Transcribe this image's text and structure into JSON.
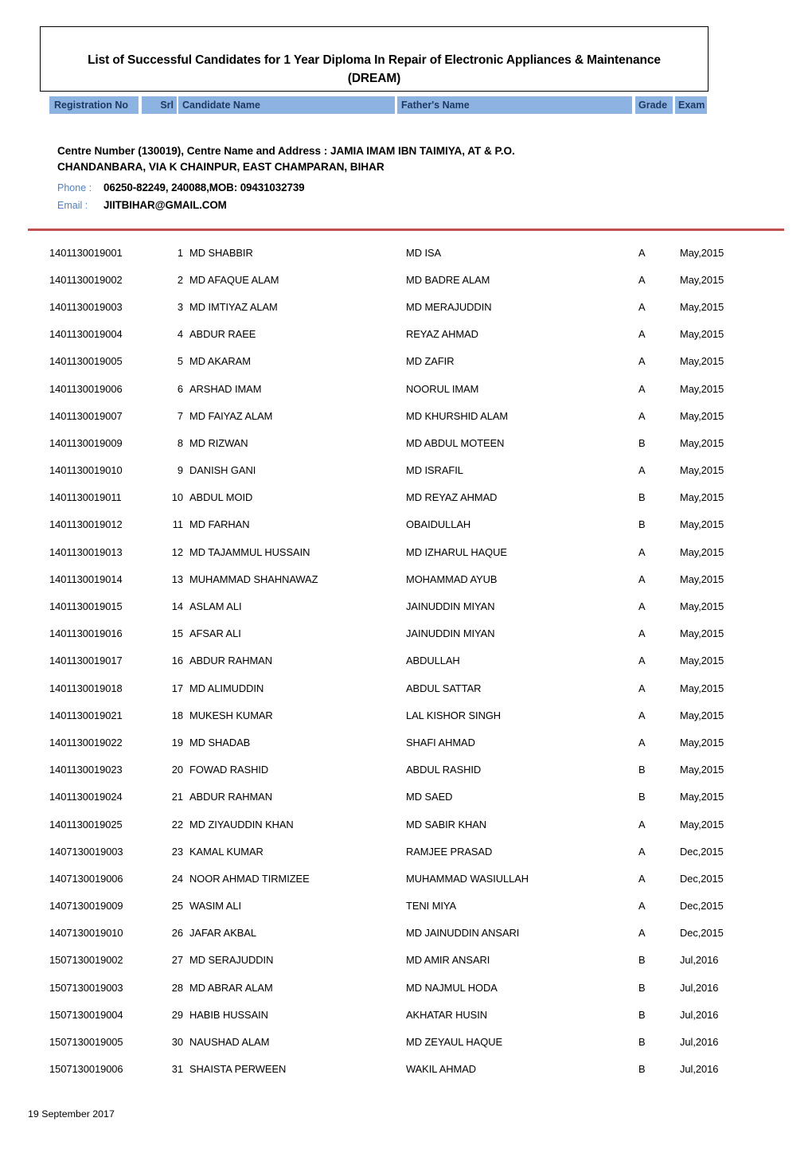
{
  "document": {
    "title_line1": "List of Successful Candidates for 1 Year Diploma In Repair of Electronic Appliances & Maintenance",
    "title_line2": "(DREAM)",
    "footer_date": "19 September 2017",
    "accent_header_bg": "#8db3e2",
    "accent_header_text": "#1f3864",
    "accent_rule": "#c0504d",
    "accent_label": "#4f81bd"
  },
  "columns": {
    "registration_no": "Registration No",
    "srl": "Srl",
    "candidate_name": "Candidate Name",
    "fathers_name": "Father's Name",
    "grade": "Grade",
    "exam": "Exam"
  },
  "centre": {
    "address_line1": "Centre Number (130019), Centre Name and Address : JAMIA IMAM IBN TAIMIYA, AT & P.O.",
    "address_line2": "CHANDANBARA,    VIA K CHAINPUR, EAST CHAMPARAN, BIHAR",
    "phone_label": "Phone :",
    "phone_value": "06250-82249, 240088,MOB: 09431032739",
    "email_label": "Email :",
    "email_value": "JIITBIHAR@GMAIL.COM"
  },
  "rows": [
    {
      "reg": "1401130019001",
      "srl": "1",
      "candidate": "MD SHABBIR",
      "father": "MD ISA",
      "grade": "A",
      "exam": "May,2015"
    },
    {
      "reg": "1401130019002",
      "srl": "2",
      "candidate": "MD AFAQUE ALAM",
      "father": "MD BADRE ALAM",
      "grade": "A",
      "exam": "May,2015"
    },
    {
      "reg": "1401130019003",
      "srl": "3",
      "candidate": "MD IMTIYAZ ALAM",
      "father": "MD MERAJUDDIN",
      "grade": "A",
      "exam": "May,2015"
    },
    {
      "reg": "1401130019004",
      "srl": "4",
      "candidate": "ABDUR RAEE",
      "father": "REYAZ AHMAD",
      "grade": "A",
      "exam": "May,2015"
    },
    {
      "reg": "1401130019005",
      "srl": "5",
      "candidate": "MD AKARAM",
      "father": "MD ZAFIR",
      "grade": "A",
      "exam": "May,2015"
    },
    {
      "reg": "1401130019006",
      "srl": "6",
      "candidate": "ARSHAD IMAM",
      "father": "NOORUL IMAM",
      "grade": "A",
      "exam": "May,2015"
    },
    {
      "reg": "1401130019007",
      "srl": "7",
      "candidate": "MD FAIYAZ ALAM",
      "father": "MD KHURSHID ALAM",
      "grade": "A",
      "exam": "May,2015"
    },
    {
      "reg": "1401130019009",
      "srl": "8",
      "candidate": "MD RIZWAN",
      "father": "MD ABDUL MOTEEN",
      "grade": "B",
      "exam": "May,2015"
    },
    {
      "reg": "1401130019010",
      "srl": "9",
      "candidate": "DANISH GANI",
      "father": "MD ISRAFIL",
      "grade": "A",
      "exam": "May,2015"
    },
    {
      "reg": "1401130019011",
      "srl": "10",
      "candidate": "ABDUL MOID",
      "father": "MD REYAZ AHMAD",
      "grade": "B",
      "exam": "May,2015"
    },
    {
      "reg": "1401130019012",
      "srl": "11",
      "candidate": "MD FARHAN",
      "father": "OBAIDULLAH",
      "grade": "B",
      "exam": "May,2015"
    },
    {
      "reg": "1401130019013",
      "srl": "12",
      "candidate": "MD TAJAMMUL HUSSAIN",
      "father": "MD IZHARUL HAQUE",
      "grade": "A",
      "exam": "May,2015"
    },
    {
      "reg": "1401130019014",
      "srl": "13",
      "candidate": "MUHAMMAD SHAHNAWAZ",
      "father": "MOHAMMAD AYUB",
      "grade": "A",
      "exam": "May,2015"
    },
    {
      "reg": "1401130019015",
      "srl": "14",
      "candidate": "ASLAM ALI",
      "father": "JAINUDDIN MIYAN",
      "grade": "A",
      "exam": "May,2015"
    },
    {
      "reg": "1401130019016",
      "srl": "15",
      "candidate": "AFSAR ALI",
      "father": "JAINUDDIN MIYAN",
      "grade": "A",
      "exam": "May,2015"
    },
    {
      "reg": "1401130019017",
      "srl": "16",
      "candidate": "ABDUR RAHMAN",
      "father": "ABDULLAH",
      "grade": "A",
      "exam": "May,2015"
    },
    {
      "reg": "1401130019018",
      "srl": "17",
      "candidate": "MD ALIMUDDIN",
      "father": "ABDUL SATTAR",
      "grade": "A",
      "exam": "May,2015"
    },
    {
      "reg": "1401130019021",
      "srl": "18",
      "candidate": "MUKESH KUMAR",
      "father": "LAL KISHOR SINGH",
      "grade": "A",
      "exam": "May,2015"
    },
    {
      "reg": "1401130019022",
      "srl": "19",
      "candidate": "MD SHADAB",
      "father": "SHAFI AHMAD",
      "grade": "A",
      "exam": "May,2015"
    },
    {
      "reg": "1401130019023",
      "srl": "20",
      "candidate": "FOWAD RASHID",
      "father": "ABDUL RASHID",
      "grade": "B",
      "exam": "May,2015"
    },
    {
      "reg": "1401130019024",
      "srl": "21",
      "candidate": "ABDUR RAHMAN",
      "father": "MD SAED",
      "grade": "B",
      "exam": "May,2015"
    },
    {
      "reg": "1401130019025",
      "srl": "22",
      "candidate": "MD ZIYAUDDIN KHAN",
      "father": "MD SABIR KHAN",
      "grade": "A",
      "exam": "May,2015"
    },
    {
      "reg": "1407130019003",
      "srl": "23",
      "candidate": "KAMAL KUMAR",
      "father": "RAMJEE PRASAD",
      "grade": "A",
      "exam": "Dec,2015"
    },
    {
      "reg": "1407130019006",
      "srl": "24",
      "candidate": "NOOR AHMAD TIRMIZEE",
      "father": "MUHAMMAD WASIULLAH",
      "grade": "A",
      "exam": "Dec,2015"
    },
    {
      "reg": "1407130019009",
      "srl": "25",
      "candidate": "WASIM ALI",
      "father": "TENI MIYA",
      "grade": "A",
      "exam": "Dec,2015"
    },
    {
      "reg": "1407130019010",
      "srl": "26",
      "candidate": "JAFAR AKBAL",
      "father": "MD JAINUDDIN ANSARI",
      "grade": "A",
      "exam": "Dec,2015"
    },
    {
      "reg": "1507130019002",
      "srl": "27",
      "candidate": "MD SERAJUDDIN",
      "father": "MD AMIR ANSARI",
      "grade": "B",
      "exam": "Jul,2016"
    },
    {
      "reg": "1507130019003",
      "srl": "28",
      "candidate": "MD ABRAR ALAM",
      "father": "MD NAJMUL HODA",
      "grade": "B",
      "exam": "Jul,2016"
    },
    {
      "reg": "1507130019004",
      "srl": "29",
      "candidate": "HABIB HUSSAIN",
      "father": "AKHATAR HUSIN",
      "grade": "B",
      "exam": "Jul,2016"
    },
    {
      "reg": "1507130019005",
      "srl": "30",
      "candidate": "NAUSHAD ALAM",
      "father": "MD ZEYAUL HAQUE",
      "grade": "B",
      "exam": "Jul,2016"
    },
    {
      "reg": "1507130019006",
      "srl": "31",
      "candidate": "SHAISTA PERWEEN",
      "father": "WAKIL AHMAD",
      "grade": "B",
      "exam": "Jul,2016"
    }
  ]
}
